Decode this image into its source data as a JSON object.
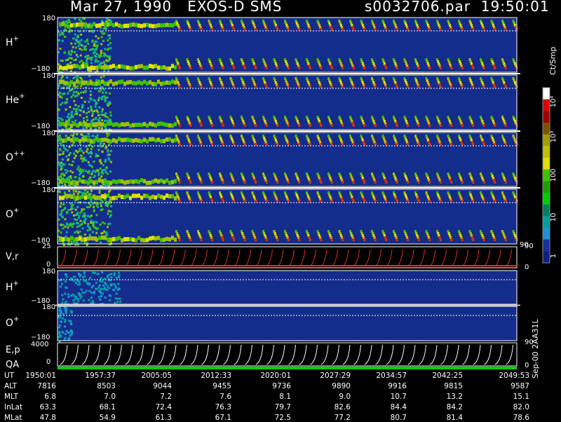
{
  "title_left": "Mar 27, 1990   EXOS-D SMS",
  "title_right": "s0032706.par  19:50:01",
  "colors": {
    "background": "#000000",
    "field": "#142c8c",
    "divider": "#ffffff",
    "velocity_curve": "#e03020",
    "energy_curve": "#ffffff",
    "qa_bar": "#00d000"
  },
  "panels": [
    {
      "label": "H",
      "sup": "+",
      "top_tick": "180",
      "bottom_tick": "−180",
      "variant": "h"
    },
    {
      "label": "He",
      "sup": "+",
      "top_tick": "180",
      "bottom_tick": "−180",
      "variant": "he"
    },
    {
      "label": "O",
      "sup": "++",
      "top_tick": "180",
      "bottom_tick": "−180",
      "variant": "opp"
    },
    {
      "label": "O",
      "sup": "+",
      "top_tick": "180",
      "bottom_tick": "−180",
      "variant": "op"
    }
  ],
  "vr_panel": {
    "label": "V,r",
    "top_tick": "25",
    "zero_tick": "0",
    "right_top": "90",
    "right_bottom": "0"
  },
  "lower_panels": [
    {
      "label": "H",
      "sup": "+",
      "top_tick": "180",
      "bottom_tick": "−180"
    },
    {
      "label": "O",
      "sup": "+",
      "top_tick": "180",
      "bottom_tick": "−180"
    }
  ],
  "ep_panel": {
    "label": "E,p",
    "label2": "QA",
    "top_tick": "4000",
    "zero_tick": "0",
    "right_top": "90",
    "right_bottom": "0"
  },
  "colorbar": {
    "unit": "Ct/Smp",
    "ticks": [
      "10⁴",
      "10³",
      "100",
      "10",
      "1"
    ],
    "colors": [
      "#ffffff",
      "#e00000",
      "#a00000",
      "#805000",
      "#a0a000",
      "#c0c000",
      "#e0e000",
      "#40c000",
      "#20a000",
      "#00d000",
      "#008060",
      "#00a0a0",
      "#2090d0",
      "#1830a0",
      "#102080"
    ]
  },
  "footer": {
    "row_labels": [
      "UT",
      "ALT",
      "MLT",
      "InLat",
      "MLat"
    ],
    "columns": [
      [
        "1950:01",
        "7816",
        "6.8",
        "63.3",
        "47.8"
      ],
      [
        "1957:37",
        "8503",
        "7.0",
        "68.1",
        "54.9"
      ],
      [
        "2005:05",
        "9044",
        "7.2",
        "72.4",
        "61.3"
      ],
      [
        "2012:33",
        "9455",
        "7.6",
        "76.3",
        "67.1"
      ],
      [
        "2020:01",
        "9736",
        "8.1",
        "79.7",
        "72.5"
      ],
      [
        "2027:29",
        "9890",
        "9.0",
        "82.6",
        "77.2"
      ],
      [
        "2034:57",
        "9916",
        "10.7",
        "84.4",
        "80.7"
      ],
      [
        "2042:25",
        "9815",
        "13.2",
        "84.2",
        "81.4"
      ],
      [
        "2049:53",
        "9587",
        "15.1",
        "82.0",
        "78.6"
      ]
    ]
  },
  "stamp": "Sep-00 2AA31L"
}
